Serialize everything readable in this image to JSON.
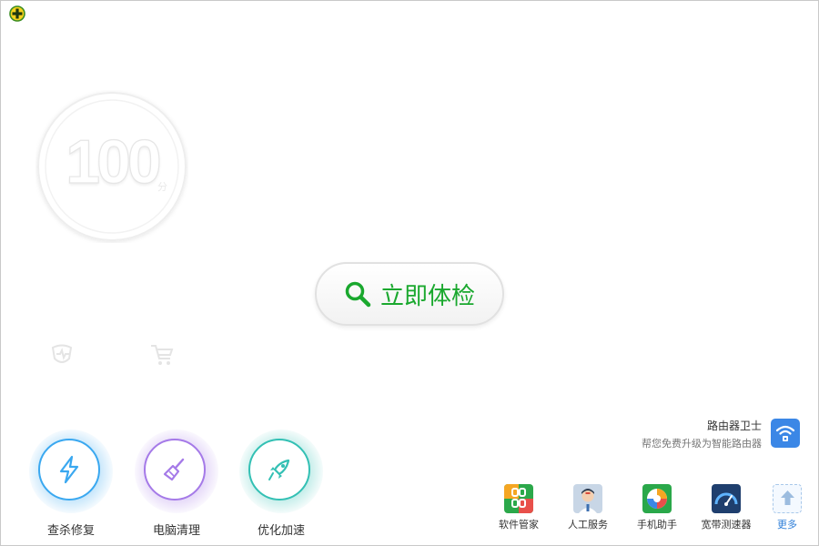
{
  "header": {
    "logo_icon": "360-plus-logo-icon"
  },
  "score": {
    "value": "100",
    "unit": "分"
  },
  "main_action": {
    "label": "立即体检",
    "icon": "search-icon",
    "color": "#1aa82e"
  },
  "router": {
    "title": "路由器卫士",
    "subtitle": "帮您免费升级为智能路由器",
    "icon": "wifi-router-icon"
  },
  "tools": [
    {
      "label": "查杀修复",
      "icon": "lightning-icon",
      "color": "#3aa8f0"
    },
    {
      "label": "电脑清理",
      "icon": "broom-icon",
      "color": "#a57ae8"
    },
    {
      "label": "优化加速",
      "icon": "rocket-icon",
      "color": "#33c0b4"
    }
  ],
  "quick_links": [
    {
      "label": "软件管家",
      "icon": "software-manager-icon"
    },
    {
      "label": "人工服务",
      "icon": "support-agent-icon"
    },
    {
      "label": "手机助手",
      "icon": "phone-assistant-icon"
    },
    {
      "label": "宽带测速器",
      "icon": "speed-test-icon"
    },
    {
      "label": "更多",
      "icon": "more-upload-icon"
    }
  ]
}
